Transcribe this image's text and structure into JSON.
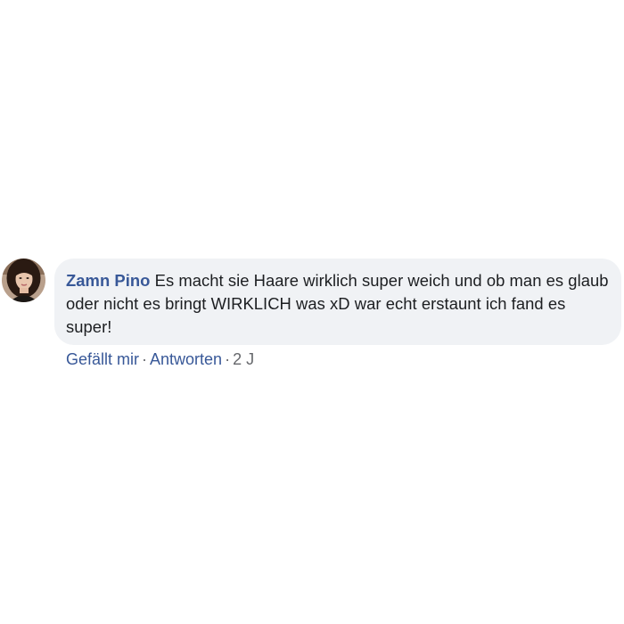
{
  "comment": {
    "author": "Zamn Pino",
    "text": "Es macht sie Haare wirklich super weich und ob man es glaub oder nicht es bringt WIRKLICH was xD war echt erstaunt ich fand es super!",
    "like_label": "Gefällt mir",
    "reply_label": "Antworten",
    "separator": "·",
    "timestamp": "2 J"
  },
  "colors": {
    "author_link": "#385898",
    "bubble_bg": "#f0f2f5",
    "text": "#1c1e21",
    "meta": "#65676b"
  },
  "icons": {
    "avatar": "profile-photo-avatar"
  }
}
